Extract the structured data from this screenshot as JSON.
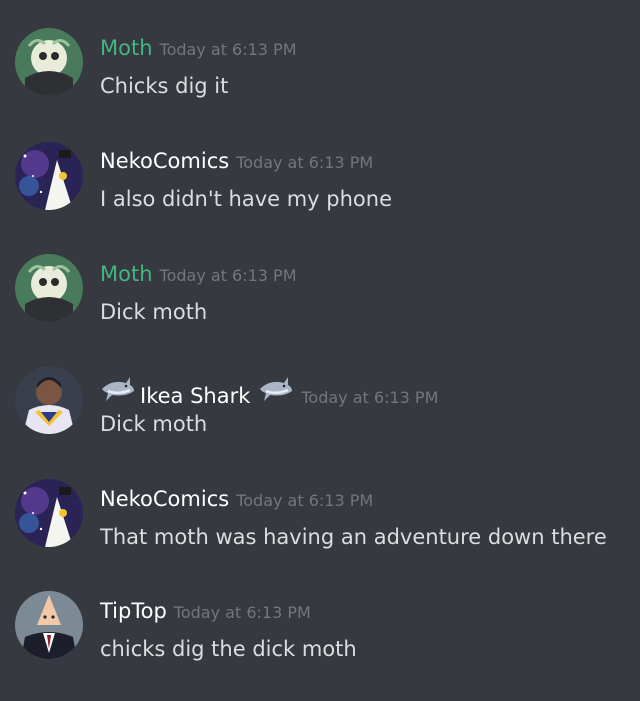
{
  "colors": {
    "background": "#36393f",
    "timestamp": "#72767d",
    "message_text": "#dcddde"
  },
  "messages": [
    {
      "author": "Moth",
      "author_color": "#43b581",
      "time": "Today at 6:13 PM",
      "text": "Chicks dig it",
      "avatar": "moth-avatar"
    },
    {
      "author": "NekoComics",
      "author_color": "#ffffff",
      "time": "Today at 6:13 PM",
      "text": "I also didn't have my phone",
      "avatar": "nekocomics-avatar"
    },
    {
      "author": "Moth",
      "author_color": "#43b581",
      "time": "Today at 6:13 PM",
      "text": "Dick moth",
      "avatar": "moth-avatar"
    },
    {
      "author": "Ikea Shark",
      "author_color": "#ffffff",
      "time": "Today at 6:13 PM",
      "text": "Dick moth",
      "avatar": "ikea-shark-avatar",
      "badges": [
        "shark-icon",
        "shark-icon"
      ]
    },
    {
      "author": "NekoComics",
      "author_color": "#ffffff",
      "time": "Today at 6:13 PM",
      "text": "That moth was having an adventure down there",
      "avatar": "nekocomics-avatar"
    },
    {
      "author": "TipTop",
      "author_color": "#ffffff",
      "time": "Today at 6:13 PM",
      "text": "chicks dig the dick moth",
      "avatar": "tiptop-avatar"
    }
  ]
}
